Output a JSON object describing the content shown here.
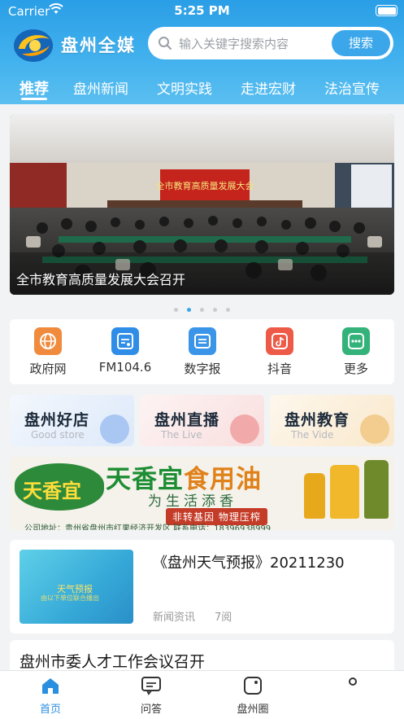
{
  "status_bar": {
    "carrier": "Carrier",
    "time": "5:25 PM"
  },
  "header": {
    "app_name": "盘州全媒",
    "search": {
      "placeholder": "输入关键字搜索内容",
      "button": "搜索"
    },
    "tabs": [
      {
        "label": "推荐",
        "active": true
      },
      {
        "label": "盘州新闻"
      },
      {
        "label": "文明实践"
      },
      {
        "label": "走进宏财"
      },
      {
        "label": "法治宣传"
      }
    ]
  },
  "banner": {
    "backdrop_text": "全市教育高质量发展大会",
    "caption": "全市教育高质量发展大会召开",
    "dots_count": 5,
    "active_dot": 1
  },
  "shortcuts": [
    {
      "label": "政府网",
      "icon": "globe-icon",
      "color": "#f08a3c"
    },
    {
      "label": "FM104.6",
      "icon": "radio-icon",
      "color": "#2f8de8"
    },
    {
      "label": "数字报",
      "icon": "newspaper-icon",
      "color": "#3a95e8"
    },
    {
      "label": "抖音",
      "icon": "douyin-icon",
      "color": "#ee5a48"
    },
    {
      "label": "更多",
      "icon": "more-icon",
      "color": "#33b27a"
    }
  ],
  "feature_cards": [
    {
      "title": "盘州好店",
      "subtitle": "Good store",
      "bg": "#e8f0fb",
      "accent": "#a9c7f2"
    },
    {
      "title": "盘州直播",
      "subtitle": "The Live",
      "bg": "#fbeaea",
      "accent": "#f2a9a9"
    },
    {
      "title": "盘州教育",
      "subtitle": "The Vide",
      "bg": "#fcf1e2",
      "accent": "#f3cd8f"
    }
  ],
  "ad": {
    "brand": "天香宜",
    "headline_brand": "天香宜",
    "headline_product": "食用油",
    "slogan": "为生活添香",
    "tag": "非转基因 物理压榨",
    "footer": "公司地址：贵州省盘州市红果经济开发区   联系电话：18396938999"
  },
  "news": [
    {
      "title": "《盘州天气预报》20211230",
      "category": "新闻资讯",
      "views": "7阅",
      "thumb_title": "天气预报",
      "thumb_sub": "由以下单位联合播出"
    },
    {
      "title": "盘州市委人才工作会议召开"
    }
  ],
  "tabbar": [
    {
      "label": "首页",
      "icon": "home-icon",
      "active": true
    },
    {
      "label": "问答",
      "icon": "chat-icon"
    },
    {
      "label": "盘州圈",
      "icon": "circle-icon"
    },
    {
      "label": "",
      "icon": "profile-icon"
    }
  ],
  "colors": {
    "primary": "#3ba7ea",
    "header_top": "#2a9ee6",
    "tab_active": "#2b8fe0"
  }
}
